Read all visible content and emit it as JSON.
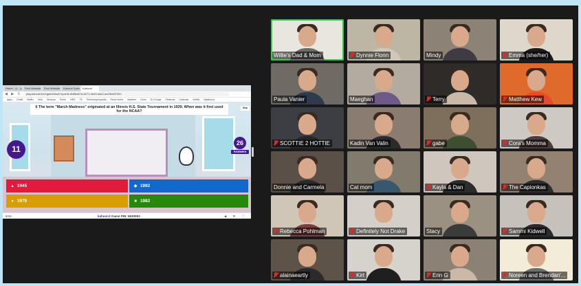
{
  "browser": {
    "tabs": [
      "Home - U... pods G Nipalooza",
      "Find Website - Quiz",
      "Find Website - Quiz",
      "Kahoot! Spring Weekend Nipal...",
      "Kahoot!"
    ],
    "url": "play.kahoot.it/v2/gameblock?quizId=8d5ba57d-4e71-4ed3-ade2-ae1fbe6f7320",
    "bookmarks": [
      "Apps",
      "Gmail",
      "Netflix",
      "Hulu",
      "Amazon",
      "Prime",
      "HBO",
      "Fb",
      "Pharmacyclopedia",
      "Read Home",
      "Weather",
      "Drive",
      "Dr Google",
      "Pinterest",
      "Calendar",
      "Netflix",
      "Nipalooza"
    ]
  },
  "kahoot": {
    "question": "6 The term \"March Madness\" originated at an Illinois H.S. State Tournament in 1939. When was it first used for the NCAA?",
    "skip_label": "Skip",
    "timer": "11",
    "answers_count": "26",
    "answers_label": "Answers",
    "options": [
      {
        "shape": "▲",
        "label": "1945",
        "color": "#e21b3c"
      },
      {
        "shape": "◆",
        "label": "1992",
        "color": "#1368ce"
      },
      {
        "shape": "●",
        "label": "1979",
        "color": "#d89e00"
      },
      {
        "shape": "■",
        "label": "1982",
        "color": "#26890c"
      }
    ],
    "question_count": "6/44",
    "brand": "kahoot.it",
    "pin_label": "Game PIN:",
    "pin": "9630093"
  },
  "participants": [
    {
      "name": "Willie's Dad & Mom",
      "muted": false,
      "speaking": true,
      "bg": "#e9e6df",
      "shirt": "#6b6b6b"
    },
    {
      "name": "Dynnie Flonn",
      "muted": true,
      "speaking": false,
      "bg": "#bdb6a4",
      "shirt": "#cfc7b8"
    },
    {
      "name": "Mindy",
      "muted": false,
      "speaking": false,
      "bg": "#8d8276",
      "shirt": "#3f3a43"
    },
    {
      "name": "Emma (she/her)",
      "muted": true,
      "speaking": false,
      "bg": "#ded8cc",
      "shirt": "#1b1b1b"
    },
    {
      "name": "Paula Vanier",
      "muted": false,
      "speaking": false,
      "bg": "#6f6a63",
      "shirt": "#2f3a4c"
    },
    {
      "name": "Maeghan",
      "muted": false,
      "speaking": false,
      "bg": "#b3aaa0",
      "shirt": "#6d5a86"
    },
    {
      "name": "Terry",
      "muted": true,
      "speaking": false,
      "bg": "#2e2b28",
      "shirt": "#c9b9a6"
    },
    {
      "name": "Matthew Kew",
      "muted": true,
      "speaking": false,
      "bg": "#e06a2c",
      "shirt": "#e84a2a"
    },
    {
      "name": "SCOTTIE 2 HOTTIE",
      "muted": true,
      "speaking": false,
      "bg": "#3d3d44",
      "shirt": "#26262b"
    },
    {
      "name": "Kadin Van Valin",
      "muted": false,
      "speaking": false,
      "bg": "#8a7c70",
      "shirt": "#2b2b2b"
    },
    {
      "name": "gabe",
      "muted": true,
      "speaking": false,
      "bg": "#7e6f5c",
      "shirt": "#3d4e33"
    },
    {
      "name": "Cora's Momma",
      "muted": true,
      "speaking": false,
      "bg": "#cfc9c3",
      "shirt": "#4e3b3b"
    },
    {
      "name": "Donnie and Carmela",
      "muted": false,
      "speaking": false,
      "bg": "#5b5048",
      "shirt": "#2a2a2a"
    },
    {
      "name": "Cat mom",
      "muted": false,
      "speaking": false,
      "bg": "#807b6c",
      "shirt": "#39586d"
    },
    {
      "name": "Kayla & Dan",
      "muted": true,
      "speaking": false,
      "bg": "#cfc7bd",
      "shirt": "#2c2c2c"
    },
    {
      "name": "The Capionkas",
      "muted": true,
      "speaking": false,
      "bg": "#938271",
      "shirt": "#2e2e2e"
    },
    {
      "name": "Rebecca Pohlman",
      "muted": true,
      "speaking": false,
      "bg": "#cfc6b8",
      "shirt": "#7a3f3f"
    },
    {
      "name": "Definitely Not Drake",
      "muted": true,
      "speaking": false,
      "bg": "#d4cfc8",
      "shirt": "#d4cfc8"
    },
    {
      "name": "Stacy",
      "muted": false,
      "speaking": false,
      "bg": "#9a9183",
      "shirt": "#3b3b3b"
    },
    {
      "name": "Sammi Kidwell",
      "muted": true,
      "speaking": false,
      "bg": "#c7c1bb",
      "shirt": "#2a2a2a"
    },
    {
      "name": "alainaeartly",
      "muted": true,
      "speaking": false,
      "bg": "#5d5348",
      "shirt": "#2b2b2b"
    },
    {
      "name": "Kirt",
      "muted": true,
      "speaking": false,
      "bg": "#d6d2cc",
      "shirt": "#1f1f1f"
    },
    {
      "name": "Erin G",
      "muted": true,
      "speaking": false,
      "bg": "#8b8175",
      "shirt": "#c9b9a6"
    },
    {
      "name": "Noreen and Brendan'...",
      "muted": true,
      "speaking": false,
      "bg": "#f2ecd9",
      "shirt": "#6d6d6d"
    }
  ]
}
